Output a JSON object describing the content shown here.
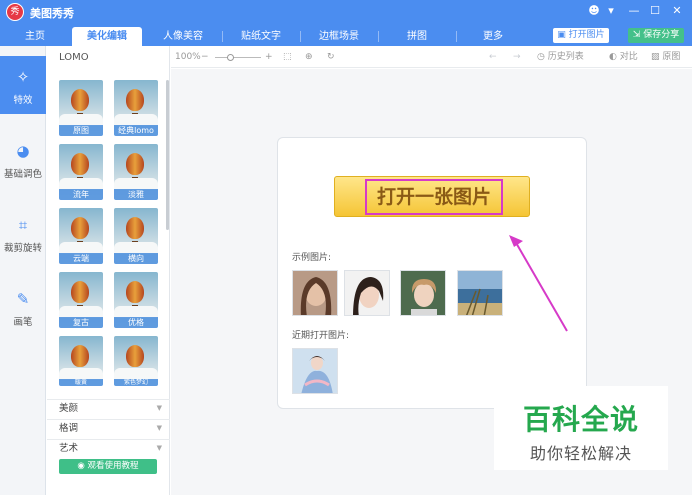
{
  "app": {
    "title": "美图秀秀",
    "logo_char": "秀"
  },
  "window_controls": [
    "☻",
    "▾",
    "—",
    "☐",
    "✕"
  ],
  "tabs": [
    {
      "label": "主页",
      "active": false
    },
    {
      "label": "美化编辑",
      "active": true
    },
    {
      "label": "人像美容",
      "active": false
    },
    {
      "label": "贴纸文字",
      "active": false
    },
    {
      "label": "边框场景",
      "active": false
    },
    {
      "label": "拼图",
      "active": false
    },
    {
      "label": "更多",
      "active": false
    }
  ],
  "header_buttons": {
    "open": "打开图片",
    "save": "保存分享"
  },
  "categories": [
    {
      "label": "特效",
      "icon": "magic-wand-icon",
      "glyph": "✧",
      "active": true
    },
    {
      "label": "基础调色",
      "icon": "palette-icon",
      "glyph": "◕",
      "active": false
    },
    {
      "label": "裁剪旋转",
      "icon": "crop-icon",
      "glyph": "⌗",
      "active": false
    },
    {
      "label": "画笔",
      "icon": "brush-icon",
      "glyph": "✎",
      "active": false
    }
  ],
  "effects_panel": {
    "heading": "LOMO",
    "effects": [
      "原图",
      "经典lomo",
      "流年",
      "淡雅",
      "云端",
      "横向",
      "复古",
      "优格",
      "暖黄",
      "紫色梦幻"
    ],
    "sections": [
      "美颜",
      "格调",
      "艺术"
    ],
    "tutorial_button": "观看使用教程"
  },
  "toolbar": {
    "zoom": "100%",
    "history": "历史列表",
    "compare": "对比",
    "original": "原图"
  },
  "canvas": {
    "open_button": "打开一张图片",
    "sample_label": "示例图片:",
    "recent_label": "近期打开图片:"
  },
  "watermark": {
    "title": "百科全说",
    "subtitle": "助你轻松解决"
  },
  "colors": {
    "brand_blue": "#4b8df0",
    "save_green": "#44c08a",
    "highlight_magenta": "#d63ac8",
    "button_yellow": "#f5c535"
  }
}
